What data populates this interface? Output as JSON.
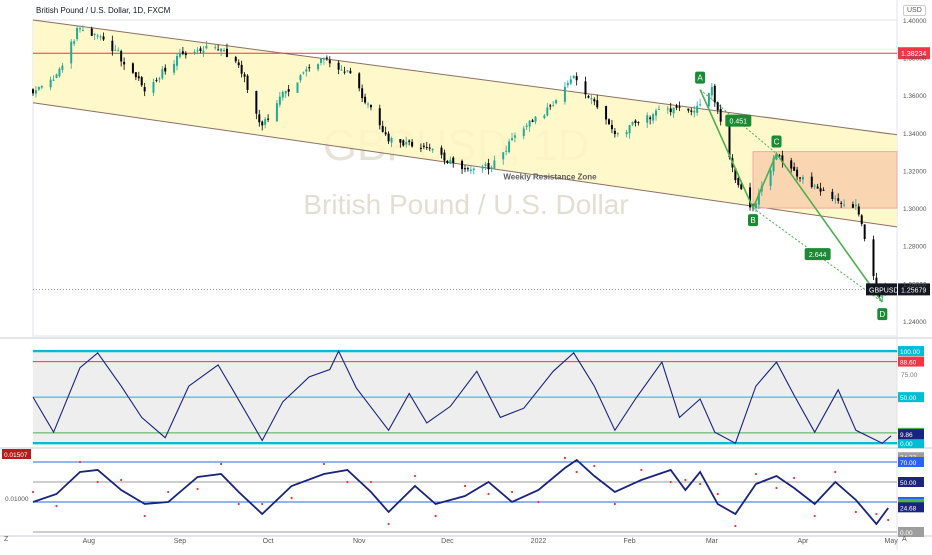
{
  "header": {
    "title": "British Pound / U.S. Dollar, 1D, FXCM",
    "currency": "USD",
    "corner_left": "Z",
    "corner_right": "A"
  },
  "watermark": {
    "symbol": "GBPUSD, 1D",
    "name": "British Pound / U.S. Dollar"
  },
  "chart_data": [
    {
      "type": "candlestick",
      "title": "British Pound / U.S. Dollar, 1D, FXCM",
      "x_ticks": [
        "Aug",
        "Sep",
        "Oct",
        "Nov",
        "Dec",
        "2022",
        "Feb",
        "Mar",
        "Apr",
        "May"
      ],
      "x_range": [
        "2021-07-13",
        "2022-05-03"
      ],
      "y_ticks": [
        "1.40000",
        "1.38000",
        "1.36000",
        "1.34000",
        "1.32000",
        "1.30000",
        "1.28000",
        "1.26000",
        "1.24000"
      ],
      "y_range": [
        1.232,
        1.4
      ],
      "close_path": [
        [
          "2021-07-13",
          1.362
        ],
        [
          "2021-07-20",
          1.368
        ],
        [
          "2021-07-29",
          1.397
        ],
        [
          "2021-08-10",
          1.384
        ],
        [
          "2021-08-20",
          1.363
        ],
        [
          "2021-09-02",
          1.383
        ],
        [
          "2021-09-14",
          1.385
        ],
        [
          "2021-09-21",
          1.377
        ],
        [
          "2021-09-29",
          1.343
        ],
        [
          "2021-10-06",
          1.36
        ],
        [
          "2021-10-20",
          1.381
        ],
        [
          "2021-10-29",
          1.37
        ],
        [
          "2021-11-11",
          1.337
        ],
        [
          "2021-11-25",
          1.331
        ],
        [
          "2021-12-08",
          1.319
        ],
        [
          "2021-12-15",
          1.322
        ],
        [
          "2021-12-27",
          1.342
        ],
        [
          "2022-01-06",
          1.355
        ],
        [
          "2022-01-13",
          1.371
        ],
        [
          "2022-01-27",
          1.339
        ],
        [
          "2022-02-10",
          1.351
        ],
        [
          "2022-02-23",
          1.352
        ],
        [
          "2022-03-01",
          1.363
        ],
        [
          "2022-03-10",
          1.311
        ],
        [
          "2022-03-15",
          1.3
        ],
        [
          "2022-03-23",
          1.328
        ],
        [
          "2022-04-06",
          1.309
        ],
        [
          "2022-04-19",
          1.301
        ],
        [
          "2022-04-22",
          1.285
        ],
        [
          "2022-04-27",
          1.251
        ],
        [
          "2022-04-29",
          1.257
        ]
      ],
      "last_price": {
        "label": "GBPUSD",
        "value": "1.25679"
      },
      "horizontal_levels": [
        {
          "label": "1.38234",
          "value": 1.38234,
          "color": "#f23645"
        }
      ],
      "channel": {
        "upper": [
          [
            "2021-07-13",
            1.4
          ],
          [
            "2022-05-03",
            1.339
          ]
        ],
        "lower": [
          [
            "2021-07-13",
            1.356
          ],
          [
            "2022-05-03",
            1.29
          ]
        ]
      },
      "zone": {
        "label": "Weekly Resistance Zone",
        "from": "2022-03-15",
        "to": "2022-05-03",
        "top": 1.33,
        "bottom": 1.3
      },
      "pattern": [
        {
          "label": "A",
          "date": "2022-02-25",
          "value": 1.363
        },
        {
          "label": "B",
          "date": "2022-03-15",
          "value": 1.3
        },
        {
          "label": "C",
          "date": "2022-03-23",
          "value": 1.329
        },
        {
          "label": "D",
          "date": "2022-04-28",
          "value": 1.25
        }
      ],
      "ratios": [
        "0.451",
        "2.644"
      ],
      "colors": {
        "up": "#22ab94",
        "down": "#000000",
        "channel": "#fff7c2",
        "zone": "#f7c9a9",
        "pattern": "#4caf50"
      }
    },
    {
      "type": "line",
      "name": "Stochastic RSI",
      "y_range": [
        -3,
        112
      ],
      "hlines": [
        {
          "label": "100.00",
          "value": 100,
          "color": "#00bcd4"
        },
        {
          "label": "88.60",
          "value": 88.6,
          "color": "#f23645"
        },
        {
          "label": "50.00",
          "value": 50,
          "color": "#00bcd4"
        },
        {
          "label": "11.30",
          "value": 11.3,
          "color": "#4caf50"
        },
        {
          "label": "0.00",
          "value": 0,
          "color": "#00bcd4"
        }
      ],
      "axis_labels": [
        "75.00"
      ],
      "series": [
        {
          "last_label": "9.86",
          "points": [
            [
              "2021-07-13",
              50
            ],
            [
              "2021-07-20",
              12
            ],
            [
              "2021-07-29",
              82
            ],
            [
              "2021-08-04",
              98
            ],
            [
              "2021-08-12",
              62
            ],
            [
              "2021-08-19",
              28
            ],
            [
              "2021-08-27",
              6
            ],
            [
              "2021-09-04",
              62
            ],
            [
              "2021-09-14",
              85
            ],
            [
              "2021-09-19",
              58
            ],
            [
              "2021-09-29",
              3
            ],
            [
              "2021-10-06",
              45
            ],
            [
              "2021-10-15",
              72
            ],
            [
              "2021-10-22",
              80
            ],
            [
              "2021-10-25",
              100
            ],
            [
              "2021-10-31",
              60
            ],
            [
              "2021-11-11",
              14
            ],
            [
              "2021-11-18",
              54
            ],
            [
              "2021-11-24",
              22
            ],
            [
              "2021-12-02",
              40
            ],
            [
              "2021-12-11",
              78
            ],
            [
              "2021-12-19",
              28
            ],
            [
              "2021-12-27",
              38
            ],
            [
              "2022-01-06",
              78
            ],
            [
              "2022-01-13",
              98
            ],
            [
              "2022-01-20",
              62
            ],
            [
              "2022-01-27",
              14
            ],
            [
              "2022-02-03",
              48
            ],
            [
              "2022-02-12",
              88
            ],
            [
              "2022-02-18",
              28
            ],
            [
              "2022-02-25",
              48
            ],
            [
              "2022-03-02",
              12
            ],
            [
              "2022-03-09",
              0
            ],
            [
              "2022-03-16",
              62
            ],
            [
              "2022-03-23",
              88
            ],
            [
              "2022-03-29",
              52
            ],
            [
              "2022-04-05",
              12
            ],
            [
              "2022-04-13",
              58
            ],
            [
              "2022-04-19",
              14
            ],
            [
              "2022-04-28",
              0
            ],
            [
              "2022-05-01",
              8
            ]
          ]
        }
      ]
    },
    {
      "type": "line",
      "name": "Oscillator",
      "y_range": [
        -2,
        82
      ],
      "hlines": [
        {
          "label": "74.77",
          "value": 74.77,
          "color": "#9e9e9e"
        },
        {
          "label": "70.00",
          "value": 70,
          "color": "#2962ff"
        },
        {
          "label": "50.00",
          "value": 50,
          "color": "#9e9e9e"
        },
        {
          "label": "30.00",
          "value": 30,
          "color": "#2962ff"
        },
        {
          "label": "27.99",
          "value": 27.99,
          "color": "#4caf50"
        },
        {
          "label": "24.68",
          "value": 24.68,
          "color": "#1a237e"
        },
        {
          "label": "0.00",
          "value": 0,
          "color": "#9e9e9e"
        }
      ],
      "left_labels": [
        {
          "label": "0.01507",
          "value": 78
        },
        {
          "label": "0.01000",
          "value": 34
        }
      ],
      "series": [
        {
          "last_label": "24.68",
          "points": [
            [
              "2021-07-13",
              30
            ],
            [
              "2021-07-21",
              38
            ],
            [
              "2021-07-29",
              60
            ],
            [
              "2021-08-04",
              62
            ],
            [
              "2021-08-12",
              42
            ],
            [
              "2021-08-20",
              28
            ],
            [
              "2021-08-28",
              30
            ],
            [
              "2021-09-07",
              55
            ],
            [
              "2021-09-15",
              58
            ],
            [
              "2021-09-21",
              40
            ],
            [
              "2021-09-29",
              18
            ],
            [
              "2021-10-09",
              46
            ],
            [
              "2021-10-20",
              58
            ],
            [
              "2021-10-28",
              62
            ],
            [
              "2021-11-05",
              40
            ],
            [
              "2021-11-11",
              20
            ],
            [
              "2021-11-20",
              46
            ],
            [
              "2021-11-27",
              28
            ],
            [
              "2021-12-07",
              36
            ],
            [
              "2021-12-15",
              50
            ],
            [
              "2021-12-23",
              30
            ],
            [
              "2022-01-01",
              42
            ],
            [
              "2022-01-10",
              64
            ],
            [
              "2022-01-14",
              72
            ],
            [
              "2022-01-20",
              56
            ],
            [
              "2022-01-27",
              40
            ],
            [
              "2022-02-05",
              52
            ],
            [
              "2022-02-15",
              62
            ],
            [
              "2022-02-20",
              42
            ],
            [
              "2022-02-25",
              60
            ],
            [
              "2022-03-03",
              28
            ],
            [
              "2022-03-09",
              18
            ],
            [
              "2022-03-16",
              48
            ],
            [
              "2022-03-23",
              56
            ],
            [
              "2022-03-29",
              44
            ],
            [
              "2022-04-05",
              28
            ],
            [
              "2022-04-12",
              50
            ],
            [
              "2022-04-19",
              32
            ],
            [
              "2022-04-26",
              8
            ],
            [
              "2022-04-30",
              24
            ]
          ]
        }
      ]
    }
  ]
}
